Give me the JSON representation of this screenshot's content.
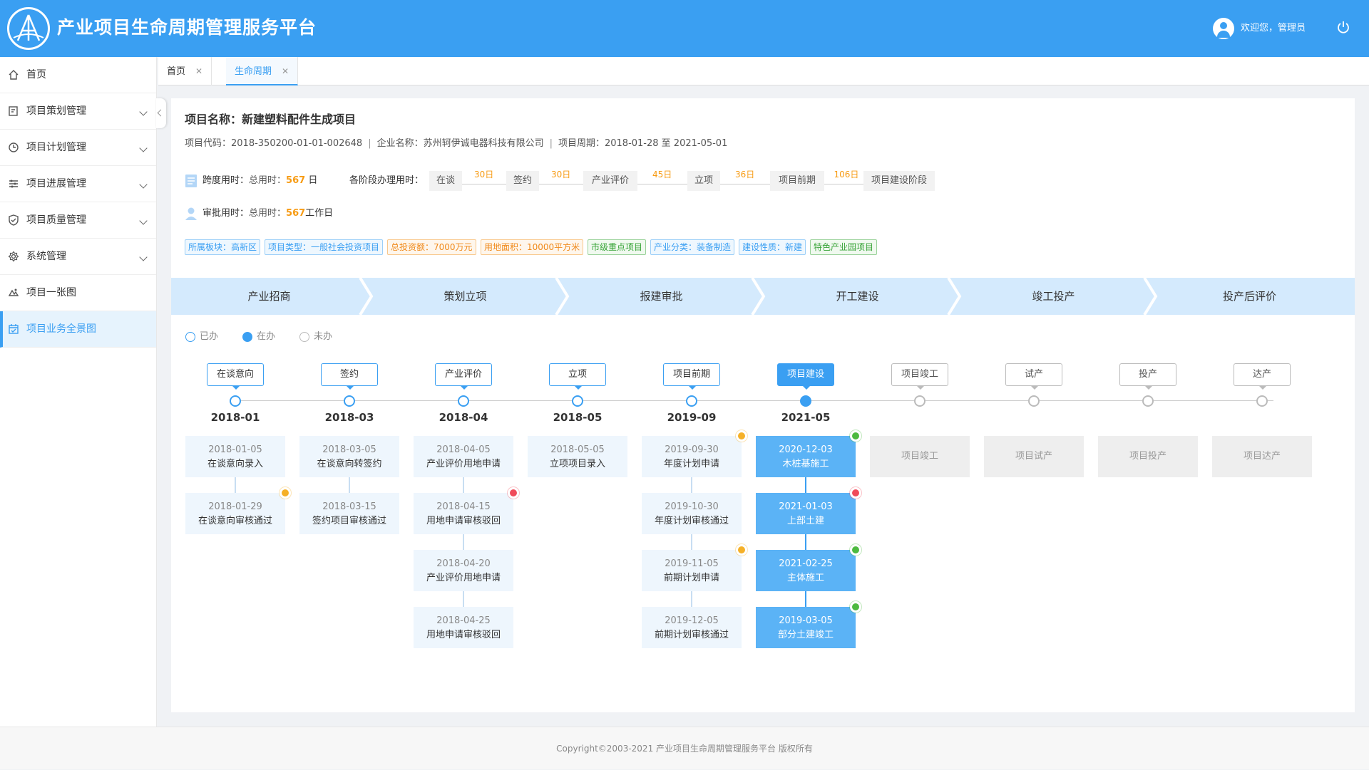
{
  "header": {
    "title": "产业项目生命周期管理服务平台",
    "welcome": "欢迎您，管理员"
  },
  "sidebar": {
    "items": [
      {
        "label": "首页",
        "icon": "home-icon"
      },
      {
        "label": "项目策划管理",
        "icon": "plan-icon"
      },
      {
        "label": "项目计划管理",
        "icon": "schedule-icon"
      },
      {
        "label": "项目进展管理",
        "icon": "progress-icon"
      },
      {
        "label": "项目质量管理",
        "icon": "shield-icon"
      },
      {
        "label": "系统管理",
        "icon": "gear-icon"
      },
      {
        "label": "项目一张图",
        "icon": "map-icon"
      },
      {
        "label": "项目业务全景图",
        "icon": "panorama-icon"
      }
    ]
  },
  "tabs": [
    {
      "label": "首页"
    },
    {
      "label": "生命周期"
    }
  ],
  "project": {
    "name": "项目名称：新建塑料配件生成项目",
    "code": "项目代码：2018-350200-01-01-002648",
    "company": "企业名称：苏州轲伊诚电器科技有限公司",
    "period": "项目周期：2018-01-28 至 2021-05-01"
  },
  "span": {
    "label": "跨度用时：",
    "prefix": "总用时：",
    "value": "567",
    "unit": "日"
  },
  "approve": {
    "label": "审批用时：",
    "prefix": "总用时：",
    "value": "567",
    "unit": "工作日"
  },
  "stage_time": {
    "label": "各阶段办理用时：",
    "stages": [
      "在谈",
      "签约",
      "产业评价",
      "立项",
      "项目前期",
      "项目建设阶段"
    ],
    "days": [
      "30日",
      "30日",
      "45日",
      "36日",
      "106日"
    ]
  },
  "tags": [
    {
      "text": "所属板块：高新区",
      "color": "blue"
    },
    {
      "text": "项目类型：一般社会投资项目",
      "color": "blue"
    },
    {
      "text": "总投资额：7000万元",
      "color": "orange"
    },
    {
      "text": "用地面积：10000平方米",
      "color": "orange"
    },
    {
      "text": "市级重点项目",
      "color": "green"
    },
    {
      "text": "产业分类：装备制造",
      "color": "blue"
    },
    {
      "text": "建设性质：新建",
      "color": "blue"
    },
    {
      "text": "特色产业园项目",
      "color": "green"
    }
  ],
  "phases": [
    "产业招商",
    "策划立项",
    "报建审批",
    "开工建设",
    "竣工投产",
    "投产后评价"
  ],
  "legend": [
    {
      "label": "已办"
    },
    {
      "label": "在办"
    },
    {
      "label": "未办"
    }
  ],
  "milestones": [
    {
      "label": "在谈意向",
      "year": "2018-01",
      "status": "done",
      "cards": [
        {
          "date": "2018-01-05",
          "text": "在谈意向录入"
        },
        {
          "date": "2018-01-29",
          "text": "在谈意向审核通过",
          "dot": "#f5b027"
        }
      ]
    },
    {
      "label": "签约",
      "year": "2018-03",
      "status": "done",
      "cards": [
        {
          "date": "2018-03-05",
          "text": "在谈意向转签约"
        },
        {
          "date": "2018-03-15",
          "text": "签约项目审核通过"
        }
      ]
    },
    {
      "label": "产业评价",
      "year": "2018-04",
      "status": "done",
      "cards": [
        {
          "date": "2018-04-05",
          "text": "产业评价用地申请"
        },
        {
          "date": "2018-04-15",
          "text": "用地申请审核驳回",
          "dot": "#f04b5a"
        },
        {
          "date": "2018-04-20",
          "text": "产业评价用地申请"
        },
        {
          "date": "2018-04-25",
          "text": "用地申请审核驳回"
        }
      ]
    },
    {
      "label": "立项",
      "year": "2018-05",
      "status": "done",
      "cards": [
        {
          "date": "2018-05-05",
          "text": "立项项目录入"
        }
      ]
    },
    {
      "label": "项目前期",
      "year": "2019-09",
      "status": "done",
      "cards": [
        {
          "date": "2019-09-30",
          "text": "年度计划申请",
          "dot": "#f5b027"
        },
        {
          "date": "2019-10-30",
          "text": "年度计划审核通过"
        },
        {
          "date": "2019-11-05",
          "text": "前期计划申请",
          "dot": "#f5b027"
        },
        {
          "date": "2019-12-05",
          "text": "前期计划审核通过"
        }
      ]
    },
    {
      "label": "项目建设",
      "year": "2021-05",
      "status": "cur",
      "cards": [
        {
          "date": "2020-12-03",
          "text": "木桩基施工",
          "dot": "#4cba3f"
        },
        {
          "date": "2021-01-03",
          "text": "上部土建",
          "dot": "#f04b5a"
        },
        {
          "date": "2021-02-25",
          "text": "主体施工",
          "dot": "#4cba3f"
        },
        {
          "date": "2019-03-05",
          "text": "部分土建竣工",
          "dot": "#4cba3f"
        }
      ]
    },
    {
      "label": "项目竣工",
      "year": "",
      "status": "todo",
      "cards": [
        {
          "date": "",
          "text": "项目竣工"
        }
      ]
    },
    {
      "label": "试产",
      "year": "",
      "status": "todo",
      "cards": [
        {
          "date": "",
          "text": "项目试产"
        }
      ]
    },
    {
      "label": "投产",
      "year": "",
      "status": "todo",
      "cards": [
        {
          "date": "",
          "text": "项目投产"
        }
      ]
    },
    {
      "label": "达产",
      "year": "",
      "status": "todo",
      "cards": [
        {
          "date": "",
          "text": "项目达产"
        }
      ]
    }
  ],
  "footer": {
    "text": "Copyright©2003-2021 产业项目生命周期管理服务平台 版权所有"
  },
  "colors": {
    "primary": "#3a9ff2",
    "accent": "#f79b13"
  }
}
